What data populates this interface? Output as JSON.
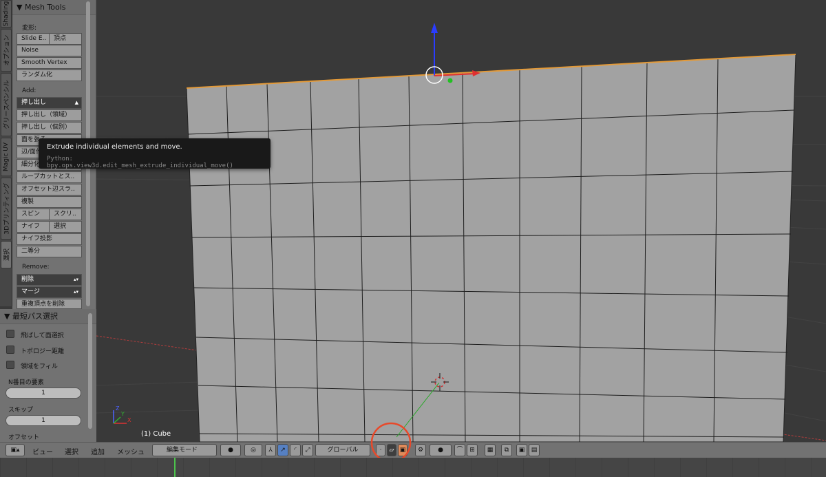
{
  "vtabs": [
    "Shading",
    "オプション",
    "グリースペンシル",
    "Magic UV",
    "3Dプリンティング",
    "選択"
  ],
  "tool_panel": {
    "title": "Mesh Tools",
    "deform_label": "変形:",
    "slide_edge": "Slide E..",
    "vertex": "頂点",
    "noise": "Noise",
    "smooth_vertex": "Smooth Vertex",
    "randomize": "ランダム化",
    "add_label": "Add:",
    "extrude": "押し出し",
    "extrude_region": "押し出し（領域）",
    "extrude_individual": "押し出し（個別）",
    "make_face": "面を張る",
    "edge_face": "辺/面作",
    "subdivide": "細分化",
    "loopcut": "ループカットとス..",
    "offset_edge": "オフセット辺スラ..",
    "duplicate": "複製",
    "spin": "スピン",
    "screw": "スクリ..",
    "knife": "ナイフ",
    "select": "選択",
    "knife_project": "ナイフ投影",
    "bisect": "二等分",
    "remove_label": "Remove:",
    "delete": "削除",
    "merge": "マージ",
    "remove_doubles": "重複頂点を削除"
  },
  "shortest_path": {
    "title": "最短パス選択",
    "opt1": "飛ばして面選択",
    "opt2": "トポロジー距離",
    "opt3": "領域をフィル",
    "nth_label": "N番目の要素",
    "nth_value": "1",
    "skip_label": "スキップ",
    "skip_value": "1",
    "offset_label": "オフセット"
  },
  "tooltip": {
    "line1": "Extrude individual elements and move.",
    "line2": "Python: bpy.ops.view3d.edit_mesh_extrude_individual_move()"
  },
  "viewport": {
    "object_label": "(1) Cube",
    "axis_z": "Z",
    "axis_x": "X",
    "axis_y": "Y"
  },
  "header": {
    "view": "ビュー",
    "select": "選択",
    "add": "追加",
    "mesh": "メッシュ",
    "mode": "編集モード",
    "orientation": "グローバル"
  },
  "colors": {
    "annotation": "#e8492a",
    "selected_edge": "#e39a39",
    "mesh_face": "#a2a2a2"
  }
}
